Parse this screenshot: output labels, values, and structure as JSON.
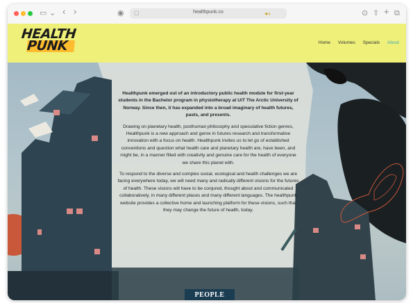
{
  "browser": {
    "url": "healthpunk.co"
  },
  "site": {
    "logo_line1": "HEALTH",
    "logo_line2": "PUNK",
    "nav": [
      "Home",
      "Volumes",
      "Specials",
      "About"
    ],
    "active_nav": "About"
  },
  "content": {
    "paragraph1": "Healthpunk emerged out of an introductory public health module for first-year students in the Bachelor program in physiotherapy at UiT The Arctic University of Norway. Since then, it has expanded into a broad imaginary of health futures, pasts, and presents.",
    "paragraph2": "Drawing on planetary health, posthuman philosophy and speculative fiction genres, Healthpunk is a new approach and genre in futures research and transformative innovation with a focus on health. Healthpunk invites us to let go of established conventions and question what health care and planetary health are, have been, and might be, in a manner filled with creativity and genuine care for the health of everyone we share this planet with.",
    "paragraph3": "To respond to the diverse and complex social, ecological and health challenges we are facing everywhere today, we will need many and radically different visions for the futures of health. These visions will have to be conjured, thought about and communicated collaboratively, in many different places and many different languages. The healthpunk website provides a collective home and launching platform for these visions, such that they may change the future of health, today.",
    "section_button": "PEOPLE"
  },
  "colors": {
    "header_bg": "#eef07a",
    "active_nav": "#3fa7b5",
    "button_bg": "#1b3d52"
  }
}
